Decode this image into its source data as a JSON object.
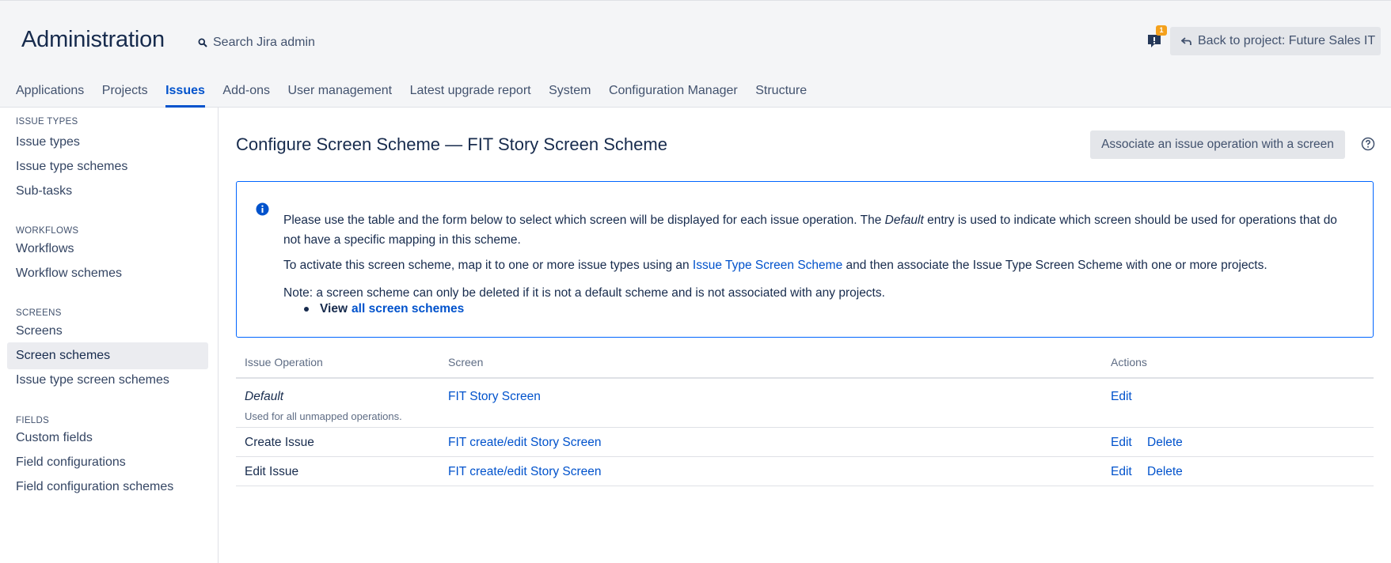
{
  "header": {
    "title": "Administration",
    "search_label": "Search Jira admin",
    "notification_count": "1",
    "back_label": "Back to project: Future Sales IT"
  },
  "topnav": [
    {
      "label": "Applications",
      "active": false
    },
    {
      "label": "Projects",
      "active": false
    },
    {
      "label": "Issues",
      "active": true
    },
    {
      "label": "Add-ons",
      "active": false
    },
    {
      "label": "User management",
      "active": false
    },
    {
      "label": "Latest upgrade report",
      "active": false
    },
    {
      "label": "System",
      "active": false
    },
    {
      "label": "Configuration Manager",
      "active": false
    },
    {
      "label": "Structure",
      "active": false
    }
  ],
  "sidebar": {
    "issue_types_heading": "ISSUE TYPES",
    "issue_types": [
      "Issue types",
      "Issue type schemes",
      "Sub-tasks"
    ],
    "workflows_heading": "WORKFLOWS",
    "workflows": [
      "Workflows",
      "Workflow schemes"
    ],
    "screens_heading": "SCREENS",
    "screens": [
      "Screens",
      "Screen schemes",
      "Issue type screen schemes"
    ],
    "selected": "Screen schemes",
    "fields_heading": "FIELDS",
    "fields": [
      "Custom fields",
      "Field configurations",
      "Field configuration schemes"
    ]
  },
  "main": {
    "title": "Configure Screen Scheme — FIT Story Screen Scheme",
    "associate_button": "Associate an issue operation with a screen"
  },
  "info": {
    "p1_before": "Please use the table and the form below to select which screen will be displayed for each issue operation. The ",
    "p1_em": "Default",
    "p1_after": " entry is used to indicate which screen should be used for operations that do not have a specific mapping in this scheme.",
    "p2_before": "To activate this screen scheme, map it to one or more issue types using an ",
    "p2_link": "Issue Type Screen Scheme",
    "p2_after": " and then associate the Issue Type Screen Scheme with one or more projects.",
    "p3": "Note: a screen scheme can only be deleted if it is not a default scheme and is not associated with any projects.",
    "bullet_view": "View",
    "bullet_link": "all screen schemes"
  },
  "table": {
    "headers": {
      "operation": "Issue Operation",
      "screen": "Screen",
      "actions": "Actions"
    },
    "rows": [
      {
        "operation": "Default",
        "description": "Used for all unmapped operations.",
        "screen": "FIT Story Screen",
        "edit": "Edit",
        "delete": ""
      },
      {
        "operation": "Create Issue",
        "description": "",
        "screen": "FIT create/edit Story Screen",
        "edit": "Edit",
        "delete": "Delete"
      },
      {
        "operation": "Edit Issue",
        "description": "",
        "screen": "FIT create/edit Story Screen",
        "edit": "Edit",
        "delete": "Delete"
      }
    ]
  },
  "colors": {
    "accent": "#0052cc",
    "header_bg": "#f4f5f7",
    "info_border": "#0065ff",
    "badge": "#f4a11d"
  }
}
